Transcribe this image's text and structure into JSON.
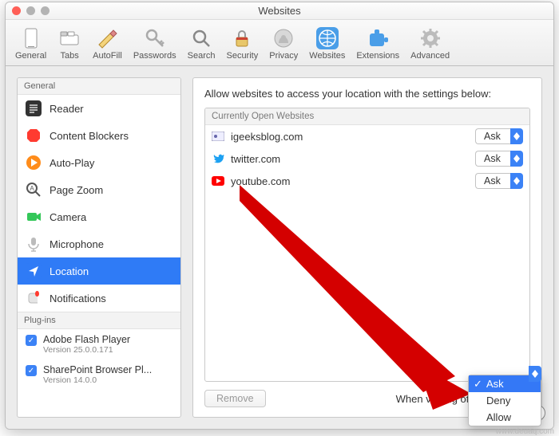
{
  "window": {
    "title": "Websites"
  },
  "toolbar": [
    {
      "id": "general",
      "label": "General"
    },
    {
      "id": "tabs",
      "label": "Tabs"
    },
    {
      "id": "autofill",
      "label": "AutoFill"
    },
    {
      "id": "passwords",
      "label": "Passwords"
    },
    {
      "id": "search",
      "label": "Search"
    },
    {
      "id": "security",
      "label": "Security"
    },
    {
      "id": "privacy",
      "label": "Privacy"
    },
    {
      "id": "websites",
      "label": "Websites",
      "active": true
    },
    {
      "id": "extensions",
      "label": "Extensions"
    },
    {
      "id": "advanced",
      "label": "Advanced"
    }
  ],
  "sidebar": {
    "general_header": "General",
    "plugins_header": "Plug-ins",
    "items": [
      {
        "id": "reader",
        "label": "Reader"
      },
      {
        "id": "content-blockers",
        "label": "Content Blockers"
      },
      {
        "id": "auto-play",
        "label": "Auto-Play"
      },
      {
        "id": "page-zoom",
        "label": "Page Zoom"
      },
      {
        "id": "camera",
        "label": "Camera"
      },
      {
        "id": "microphone",
        "label": "Microphone"
      },
      {
        "id": "location",
        "label": "Location",
        "selected": true
      },
      {
        "id": "notifications",
        "label": "Notifications"
      }
    ],
    "plugins": [
      {
        "name": "Adobe Flash Player",
        "version": "Version 25.0.0.171",
        "checked": true
      },
      {
        "name": "SharePoint Browser Pl...",
        "version": "Version 14.0.0",
        "checked": true
      }
    ]
  },
  "main": {
    "heading": "Allow websites to access your location with the settings below:",
    "open_header": "Currently Open Websites",
    "sites": [
      {
        "name": "igeeksblog.com",
        "value": "Ask",
        "icon": "igeeks"
      },
      {
        "name": "twitter.com",
        "value": "Ask",
        "icon": "twitter"
      },
      {
        "name": "youtube.com",
        "value": "Ask",
        "icon": "youtube"
      }
    ],
    "remove_label": "Remove",
    "footer_label": "When visiting other websites:",
    "footer_value": "Ask",
    "dropdown_options": [
      "Ask",
      "Deny",
      "Allow"
    ]
  },
  "watermark": "www.deuaq.com"
}
